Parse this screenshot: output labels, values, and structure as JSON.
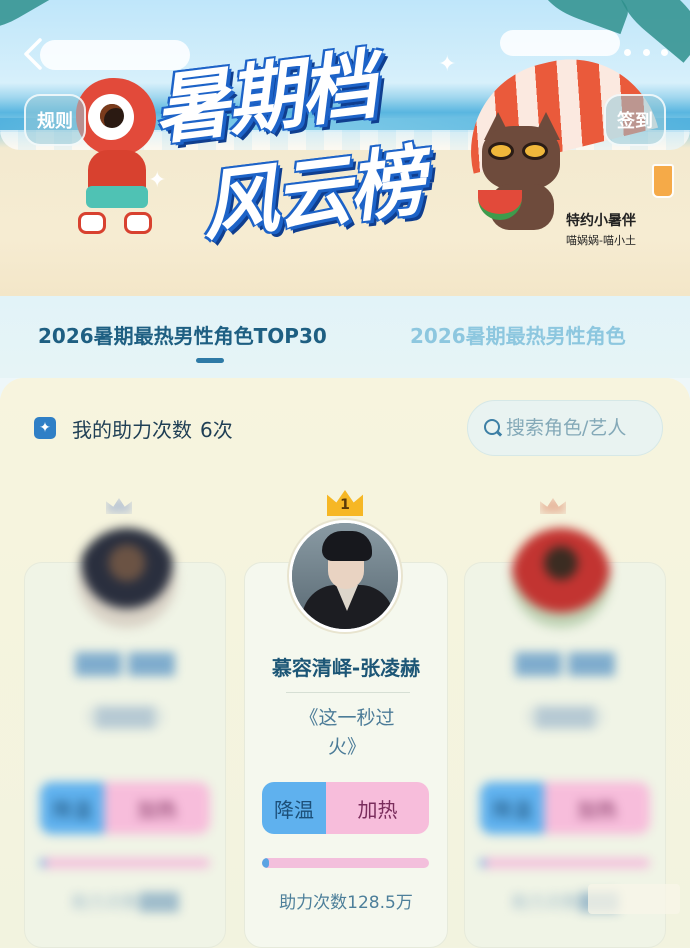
{
  "banner": {
    "title_line1": "暑期档",
    "title_line2": "风云榜",
    "rules_label": "规则",
    "checkin_label": "签到",
    "partner_title": "特约小暑伴",
    "partner_sub": "喵娲娲-喵小土"
  },
  "tabs": [
    {
      "label": "2026暑期最热男性角色TOP30",
      "active": true
    },
    {
      "label": "2026暑期最热男性角色",
      "active": false
    }
  ],
  "boost": {
    "label": "我的助力次数",
    "count": "6次"
  },
  "search": {
    "placeholder": "搜索角色/艺人"
  },
  "ranking": {
    "left": {
      "name": "███ ███",
      "work": "《████》",
      "cool_label": "降温",
      "heat_label": "加热",
      "progress": 0.03,
      "boost_total": "助力次数███"
    },
    "mid": {
      "rank": "1",
      "name": "慕容清峄-张凌赫",
      "work": "《这一秒过火》",
      "cool_label": "降温",
      "heat_label": "加热",
      "progress": 0.04,
      "boost_total": "助力次数128.5万"
    },
    "right": {
      "name": "███ ███",
      "work": "《████》",
      "cool_label": "降温",
      "heat_label": "加热",
      "progress": 0.03,
      "boost_total": "助力次数███"
    }
  },
  "colors": {
    "accent": "#1e5f82",
    "cool": "#5fb1ee",
    "heat": "#f7bddb",
    "crown": "#f6b725"
  }
}
